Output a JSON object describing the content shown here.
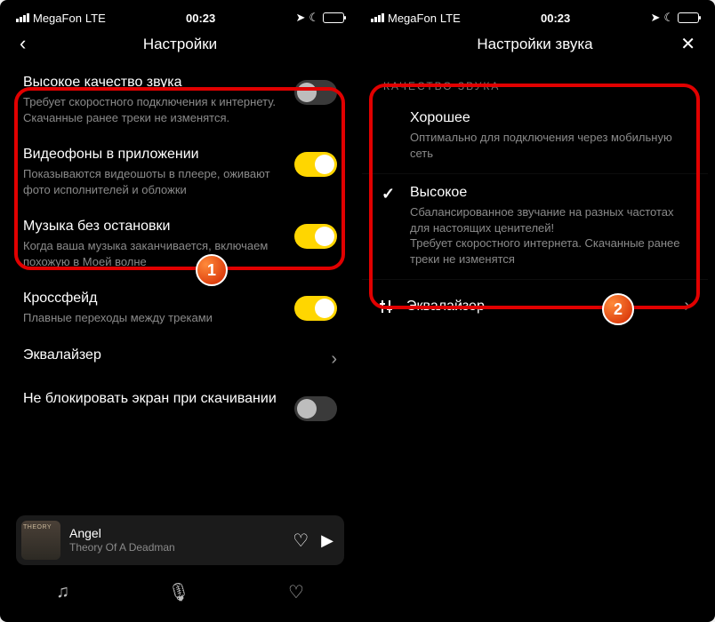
{
  "status": {
    "carrier": "MegaFon",
    "network": "LTE",
    "time": "00:23"
  },
  "left": {
    "title": "Настройки",
    "rows": [
      {
        "title": "Высокое качество звука",
        "desc": "Требует скоростного подключения к интернету. Скачанные ранее треки не изменятся.",
        "toggle": "off"
      },
      {
        "title": "Видеофоны в приложении",
        "desc": "Показываются видеошоты в плеере, оживают фото исполнителей и обложки",
        "toggle": "on"
      },
      {
        "title": "Музыка без остановки",
        "desc": "Когда ваша музыка заканчивается, включаем похожую в Моей волне",
        "toggle": "on"
      },
      {
        "title": "Кроссфейд",
        "desc": "Плавные переходы между треками",
        "toggle": "on"
      },
      {
        "title": "Эквалайзер",
        "desc": "",
        "chevron": true
      },
      {
        "title": "Не блокировать экран при скачивании",
        "desc": "",
        "toggle": "off"
      }
    ],
    "player": {
      "track": "Angel",
      "artist": "Theory Of A Deadman"
    }
  },
  "right": {
    "title": "Настройки звука",
    "section": "КАЧЕСТВО ЗВУКА",
    "items": [
      {
        "title": "Хорошее",
        "desc": "Оптимально для подключения через мобильную сеть",
        "checked": false
      },
      {
        "title": "Высокое",
        "desc": "Сбалансированное звучание на разных частотах для настоящих ценителей!\nТребует скоростного интернета. Скачанные ранее треки не изменятся",
        "checked": true
      }
    ],
    "equalizer": "Эквалайзер"
  },
  "steps": {
    "one": "1",
    "two": "2"
  }
}
